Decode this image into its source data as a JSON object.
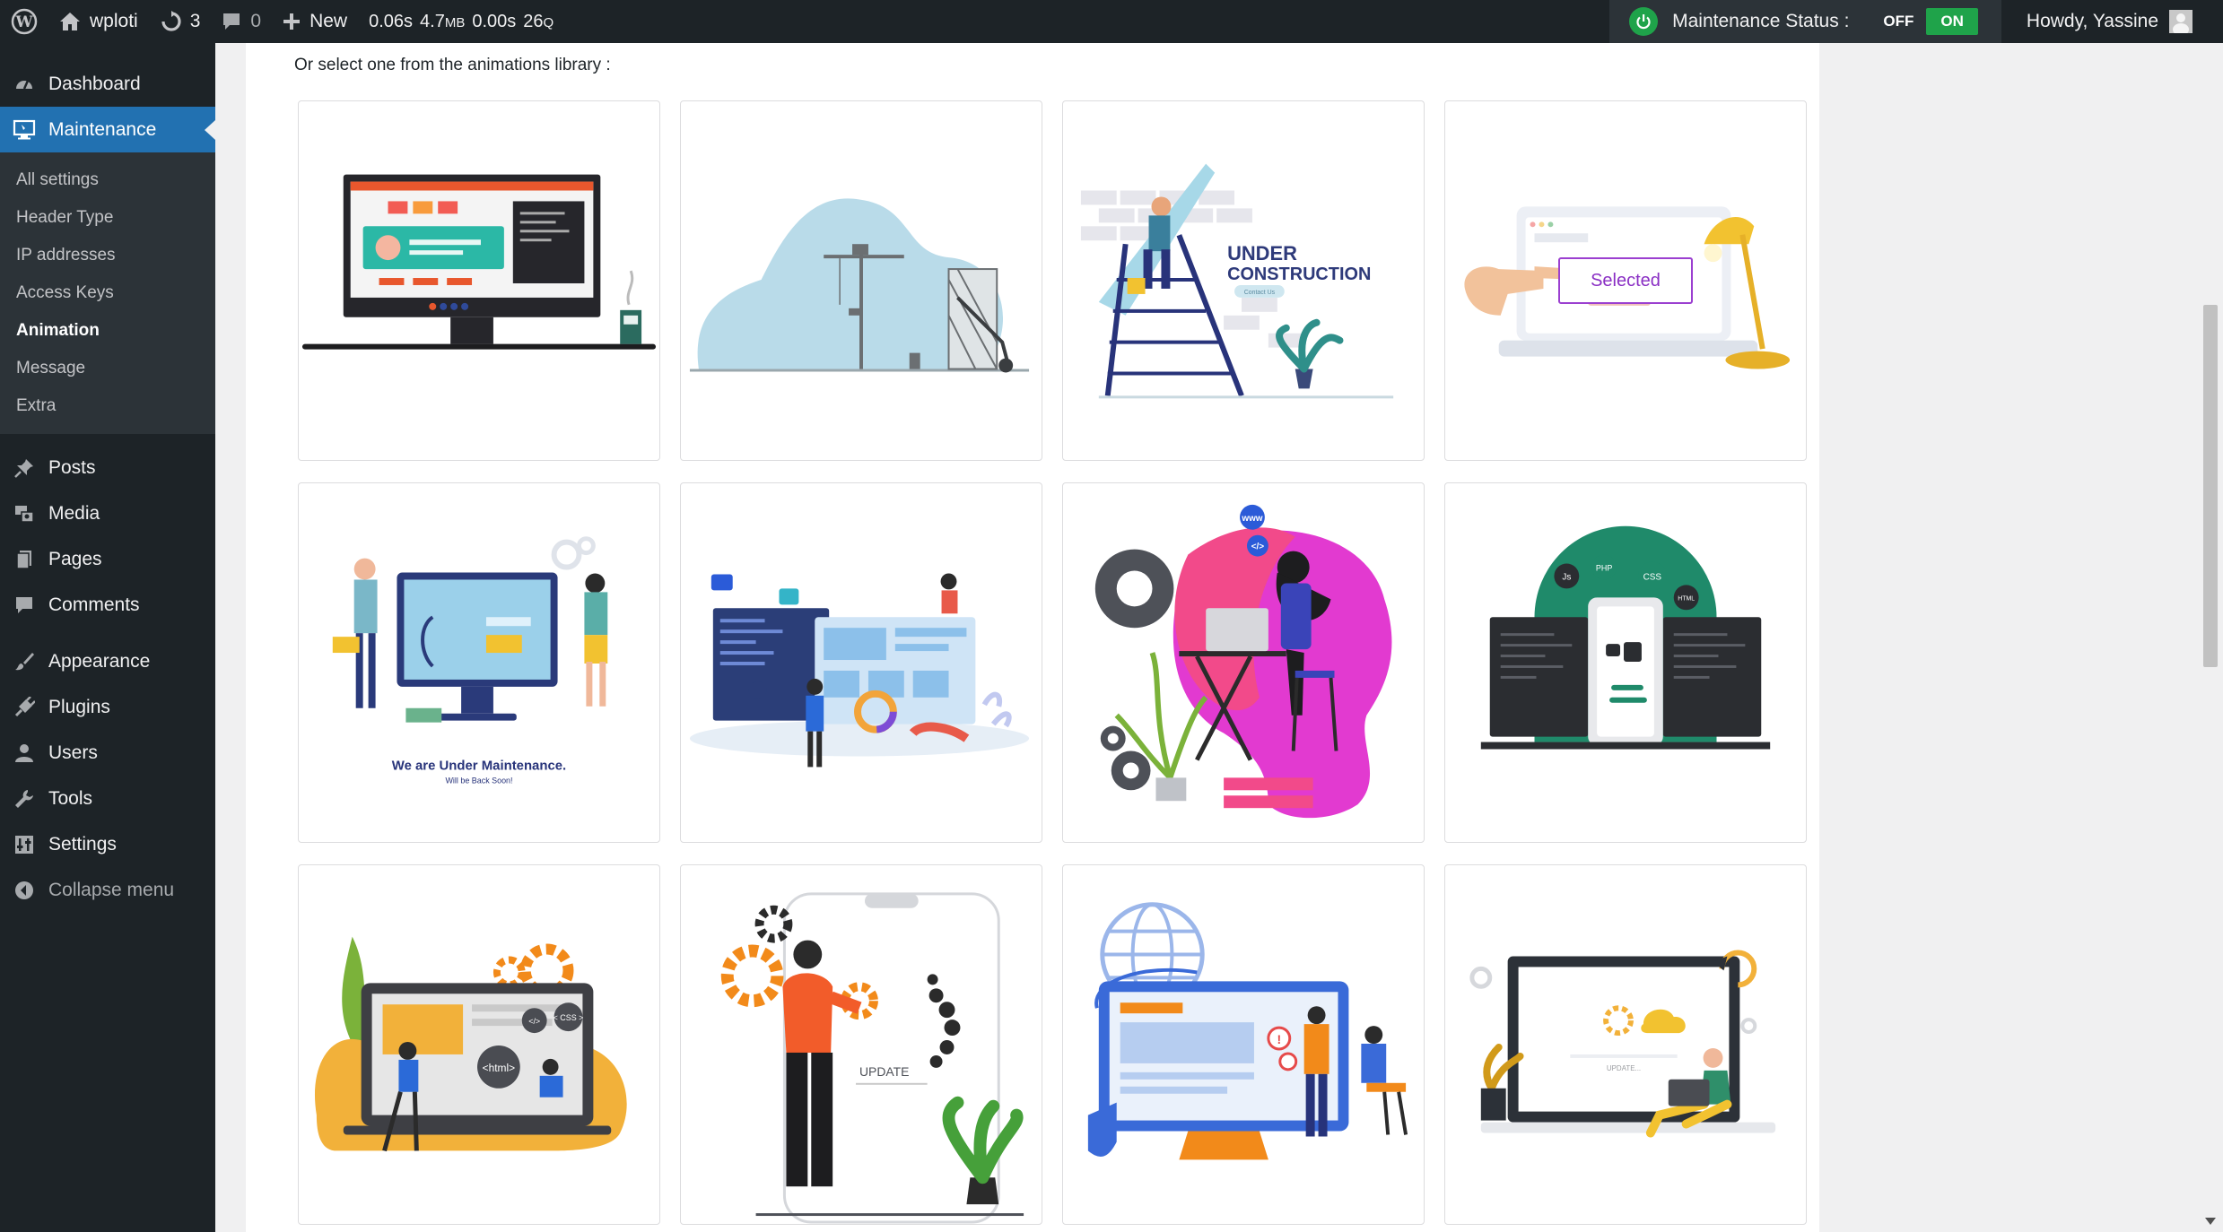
{
  "adminbar": {
    "site_name": "wploti",
    "updates_count": "3",
    "comments_count": "0",
    "new_label": "New",
    "debug_time": "0.06s",
    "debug_mem": "4.7",
    "debug_mem_unit": "MB",
    "debug_query_time": "0.00s",
    "debug_queries": "26",
    "debug_queries_unit": "Q",
    "maintenance_label": "Maintenance Status :",
    "toggle_off": "OFF",
    "toggle_on": "ON",
    "howdy": "Howdy, Yassine"
  },
  "sidebar": {
    "dashboard": "Dashboard",
    "maintenance": "Maintenance",
    "sub": [
      "All settings",
      "Header Type",
      "IP addresses",
      "Access Keys",
      "Animation",
      "Message",
      "Extra"
    ],
    "posts": "Posts",
    "media": "Media",
    "pages": "Pages",
    "comments": "Comments",
    "appearance": "Appearance",
    "plugins": "Plugins",
    "users": "Users",
    "tools": "Tools",
    "settings": "Settings",
    "collapse": "Collapse menu"
  },
  "main": {
    "library_label": "Or select one from the animations library :",
    "selected_label": "Selected",
    "card_texts": {
      "under": "UNDER",
      "construction": "CONSTRUCTION",
      "contact_us": "Contact Us",
      "maint_title": "We are Under Maintenance.",
      "maint_sub": "Will be Back Soon!",
      "www": "www",
      "code_tag": "</>",
      "js": "Js",
      "php": "PHP",
      "css": "CSS",
      "html": "HTML",
      "html_tag": "<html>",
      "css_tag": "< CSS >",
      "update": "UPDATE",
      "update_small": "UPDATE..."
    }
  },
  "colors": {
    "adminbar_bg": "#1d2327",
    "accent_blue": "#2271b1",
    "status_green": "#1fa34a",
    "selected_purple": "#9b3fd0"
  }
}
